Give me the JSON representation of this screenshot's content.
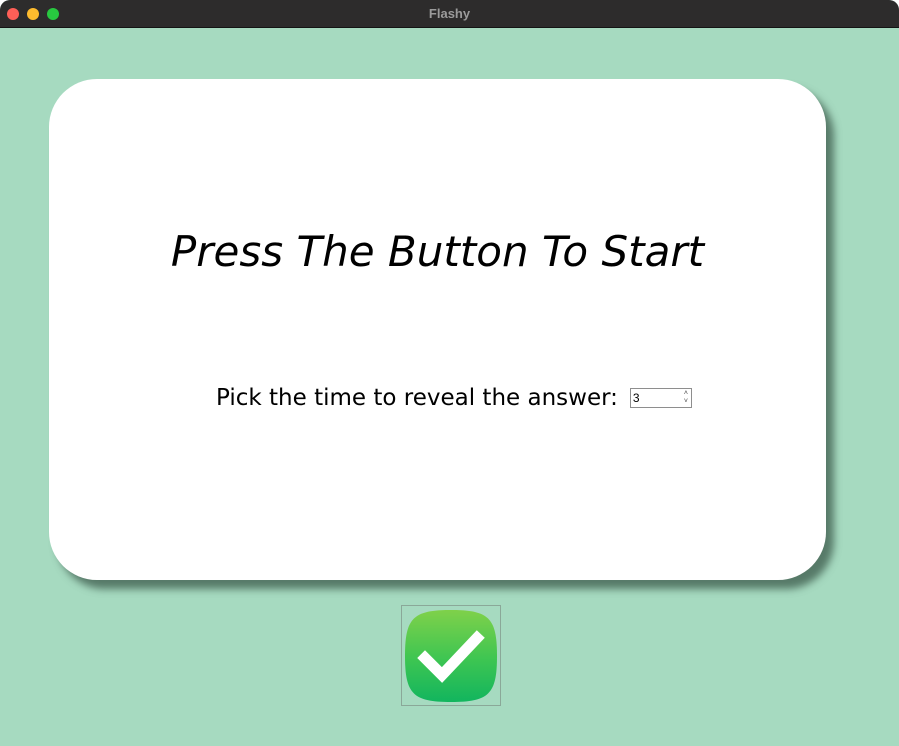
{
  "window": {
    "title": "Flashy"
  },
  "card": {
    "prompt": "Press The Button To Start",
    "timer_label": "Pick the time to reveal the answer:",
    "timer_value": "3"
  },
  "start_button": {
    "icon": "checkmark-icon",
    "color_top": "#7fd14a",
    "color_bottom": "#12b55e"
  },
  "colors": {
    "background": "#a6dac0",
    "card": "#ffffff",
    "titlebar": "#2d2c2c"
  }
}
